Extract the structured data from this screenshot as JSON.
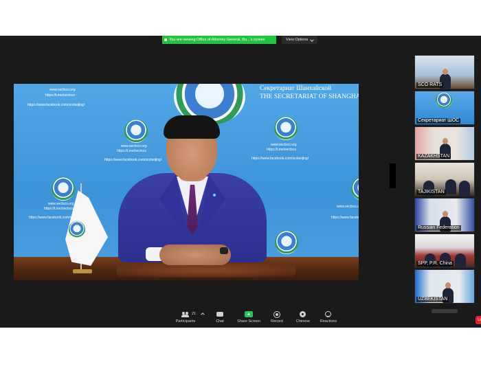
{
  "banner": {
    "text": "You are viewing Office of Attorney General, Bu...'s screen"
  },
  "view_options": {
    "label": "View Options"
  },
  "speaker_backdrop": {
    "title_ru": "Секретариат Шанхайской",
    "title_en": "THE SECRETARIAT OF SHANGHA",
    "site": "www.sectsco.org",
    "telegram": "https://t.me/sectsco",
    "twitter": "https://twitter.com/SCOSecret",
    "facebook": "https://www.facebook.com/scobeijing/"
  },
  "participants": [
    {
      "label": "SCO RATS"
    },
    {
      "label": "Секретариат ШОС"
    },
    {
      "label": "KAZAKHSTAN"
    },
    {
      "label": "TAJIKISTAN"
    },
    {
      "label": "Russian Federation"
    },
    {
      "label": "SPP, P.R. China"
    },
    {
      "label": "UZBEKISTAN"
    }
  ],
  "toolbar": {
    "participants_label": "Participants",
    "participants_count": "21",
    "chat_label": "Chat",
    "share_label": "Share Screen",
    "record_label": "Record",
    "chinese_label": "Chinese",
    "reactions_label": "Reactions",
    "end_label": "Le"
  },
  "colors": {
    "share_green": "#22c55e",
    "banner_green": "#23c341",
    "end_red": "#e0262d"
  }
}
